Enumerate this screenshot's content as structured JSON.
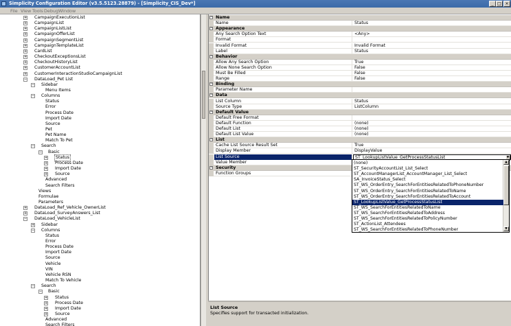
{
  "window": {
    "title": "Simplicity Configuration Editor (v3.5.5123.28879) - [Simplicity_CIS_Dev*]",
    "minimize": "_",
    "maximize": "□",
    "close": "×"
  },
  "menu": [
    "File",
    "View",
    "Tools",
    "Debug",
    "Window"
  ],
  "tree": [
    {
      "label": "CampaignExecutionList",
      "level": 1,
      "exp": "+"
    },
    {
      "label": "CampaignList",
      "level": 1,
      "exp": "+"
    },
    {
      "label": "CampaignListList",
      "level": 1,
      "exp": "+"
    },
    {
      "label": "CampaignOfferList",
      "level": 1,
      "exp": "+"
    },
    {
      "label": "CampaignSegmentList",
      "level": 1,
      "exp": "+"
    },
    {
      "label": "CampaignTemplateList",
      "level": 1,
      "exp": "+"
    },
    {
      "label": "CardList",
      "level": 1,
      "exp": "+"
    },
    {
      "label": "CheckoutExceptionsList",
      "level": 1,
      "exp": "+"
    },
    {
      "label": "CheckoutHistoryList",
      "level": 1,
      "exp": "+"
    },
    {
      "label": "CustomerAccountList",
      "level": 1,
      "exp": "+"
    },
    {
      "label": "CustomerInteractionStudioCampaignList",
      "level": 1,
      "exp": "+"
    },
    {
      "label": "DataLoad_Pet List",
      "level": 1,
      "exp": "−"
    },
    {
      "label": "Sidebar",
      "level": 2,
      "exp": "−"
    },
    {
      "label": "Menu Items",
      "level": 3,
      "exp": ""
    },
    {
      "label": "Columns",
      "level": 2,
      "exp": "−"
    },
    {
      "label": "Status",
      "level": 3,
      "exp": ""
    },
    {
      "label": "Error",
      "level": 3,
      "exp": ""
    },
    {
      "label": "Process Date",
      "level": 3,
      "exp": ""
    },
    {
      "label": "Import Date",
      "level": 3,
      "exp": ""
    },
    {
      "label": "Source",
      "level": 3,
      "exp": ""
    },
    {
      "label": "Pet",
      "level": 3,
      "exp": ""
    },
    {
      "label": "Pet Name",
      "level": 3,
      "exp": ""
    },
    {
      "label": "Match To Pet",
      "level": 3,
      "exp": ""
    },
    {
      "label": "Search",
      "level": 2,
      "exp": "−"
    },
    {
      "label": "Basic",
      "level": 3,
      "exp": "−"
    },
    {
      "label": "Status",
      "level": 4,
      "exp": "+",
      "selected": true
    },
    {
      "label": "Process Date",
      "level": 4,
      "exp": "+"
    },
    {
      "label": "Import Date",
      "level": 4,
      "exp": "+"
    },
    {
      "label": "Source",
      "level": 4,
      "exp": "+"
    },
    {
      "label": "Advanced",
      "level": 3,
      "exp": ""
    },
    {
      "label": "Search Filters",
      "level": 3,
      "exp": ""
    },
    {
      "label": "Views",
      "level": 2,
      "exp": ""
    },
    {
      "label": "Formulae",
      "level": 2,
      "exp": ""
    },
    {
      "label": "Parameters",
      "level": 2,
      "exp": ""
    },
    {
      "label": "DataLoad_Ref_Vehicle_OwnerList",
      "level": 1,
      "exp": "+"
    },
    {
      "label": "DataLoad_SurveyAnswers_List",
      "level": 1,
      "exp": "+"
    },
    {
      "label": "DataLoad_VehicleList",
      "level": 1,
      "exp": "−"
    },
    {
      "label": "Sidebar",
      "level": 2,
      "exp": "+"
    },
    {
      "label": "Columns",
      "level": 2,
      "exp": "−"
    },
    {
      "label": "Status",
      "level": 3,
      "exp": ""
    },
    {
      "label": "Error",
      "level": 3,
      "exp": ""
    },
    {
      "label": "Process Date",
      "level": 3,
      "exp": ""
    },
    {
      "label": "Import Date",
      "level": 3,
      "exp": ""
    },
    {
      "label": "Source",
      "level": 3,
      "exp": ""
    },
    {
      "label": "Vehicle",
      "level": 3,
      "exp": ""
    },
    {
      "label": "VIN",
      "level": 3,
      "exp": ""
    },
    {
      "label": "Vehicle RSN",
      "level": 3,
      "exp": ""
    },
    {
      "label": "Match To Vehicle",
      "level": 3,
      "exp": ""
    },
    {
      "label": "Search",
      "level": 2,
      "exp": "−"
    },
    {
      "label": "Basic",
      "level": 3,
      "exp": "−"
    },
    {
      "label": "Status",
      "level": 4,
      "exp": "+"
    },
    {
      "label": "Process Date",
      "level": 4,
      "exp": "+"
    },
    {
      "label": "Import Date",
      "level": 4,
      "exp": "+"
    },
    {
      "label": "Source",
      "level": 4,
      "exp": "+"
    },
    {
      "label": "Advanced",
      "level": 3,
      "exp": ""
    },
    {
      "label": "Search Filters",
      "level": 3,
      "exp": ""
    }
  ],
  "properties": [
    {
      "kind": "cat",
      "name": "Name"
    },
    {
      "kind": "prop",
      "name": "Name",
      "value": "Status"
    },
    {
      "kind": "cat",
      "name": "Appearance"
    },
    {
      "kind": "prop",
      "name": "Any Search Option Text",
      "value": "<Any>"
    },
    {
      "kind": "prop",
      "name": "Format",
      "value": ""
    },
    {
      "kind": "prop",
      "name": "Invalid Format",
      "value": "Invalid Format"
    },
    {
      "kind": "prop",
      "name": "Label",
      "value": "Status"
    },
    {
      "kind": "cat",
      "name": "Behavior"
    },
    {
      "kind": "prop",
      "name": "Allow Any Search Option",
      "value": "True"
    },
    {
      "kind": "prop",
      "name": "Allow None Search Option",
      "value": "False"
    },
    {
      "kind": "prop",
      "name": "Must Be Filled",
      "value": "False"
    },
    {
      "kind": "prop",
      "name": "Range",
      "value": "False"
    },
    {
      "kind": "cat",
      "name": "Binding"
    },
    {
      "kind": "prop",
      "name": "Parameter Name",
      "value": ""
    },
    {
      "kind": "cat",
      "name": "Data"
    },
    {
      "kind": "prop",
      "name": "List Column",
      "value": "Status"
    },
    {
      "kind": "prop",
      "name": "Source Type",
      "value": "ListColumn"
    },
    {
      "kind": "cat",
      "name": "Default Value"
    },
    {
      "kind": "prop",
      "name": "Default Free Format",
      "value": ""
    },
    {
      "kind": "prop",
      "name": "Default Function",
      "value": "(none)"
    },
    {
      "kind": "prop",
      "name": "Default List",
      "value": "(none)"
    },
    {
      "kind": "prop",
      "name": "Default List Value",
      "value": "(none)"
    },
    {
      "kind": "cat",
      "name": "List"
    },
    {
      "kind": "prop",
      "name": "Cache List Source Result Set",
      "value": "True"
    },
    {
      "kind": "prop",
      "name": "Display Member",
      "value": "DisplayValue"
    },
    {
      "kind": "prop",
      "name": "List Source",
      "value": "ST_LookupListValue_GetProcessStatusList",
      "selected": true
    },
    {
      "kind": "prop",
      "name": "Value Member",
      "value": ""
    },
    {
      "kind": "cat",
      "name": "Security"
    },
    {
      "kind": "prop",
      "name": "Function Groups",
      "value": ""
    }
  ],
  "dropdown": {
    "items": [
      "(none)",
      "ST_SecurityAccountList_List_Select",
      "ST_AccountManagerList_AccountManager_List_Select",
      "SA_InvoiceStatus_Select",
      "ST_WS_OrderEntry_SearchForEntitiesRelatedToPhoneNumber",
      "ST_WS_OrderEntry_SearchForEntitiesRelatedToName",
      "ST_WS_OrderEntry_SearchForEntitiesRelatedToAccount",
      "ST_LookupListValue_GetProcessStatusList",
      "ST_WS_SearchForEntitiesRelatedToName",
      "ST_WS_SearchForEntitiesRelatedToAddress",
      "ST_WS_SearchForEntitiesRelatedToPolicyNumber",
      "ST_ActionList_Attendees",
      "ST_WS_SearchForEntitiesRelatedToPhoneNumber"
    ],
    "active_index": 7
  },
  "description": {
    "title": "List Source",
    "text": "Specifies support for transacted initialization."
  }
}
